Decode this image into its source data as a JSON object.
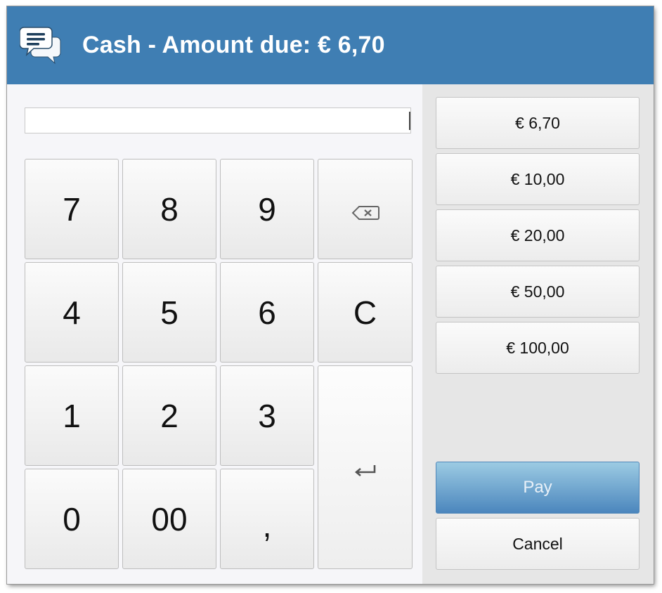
{
  "dialog": {
    "title": "Cash - Amount due: € 6,70",
    "icon": "chat-bubbles-icon",
    "accent_color": "#3f7eb3"
  },
  "amount_input": {
    "value": "",
    "placeholder": ""
  },
  "keypad": {
    "keys": {
      "k7": "7",
      "k8": "8",
      "k9": "9",
      "k4": "4",
      "k5": "5",
      "k6": "6",
      "k1": "1",
      "k2": "2",
      "k3": "3",
      "k0": "0",
      "k00": "00",
      "comma": ",",
      "clear": "C"
    },
    "backspace_icon": "backspace-icon",
    "enter_icon": "enter-icon"
  },
  "quick_amounts": [
    "€ 6,70",
    "€ 10,00",
    "€ 20,00",
    "€ 50,00",
    "€ 100,00"
  ],
  "actions": {
    "pay_label": "Pay",
    "cancel_label": "Cancel"
  }
}
